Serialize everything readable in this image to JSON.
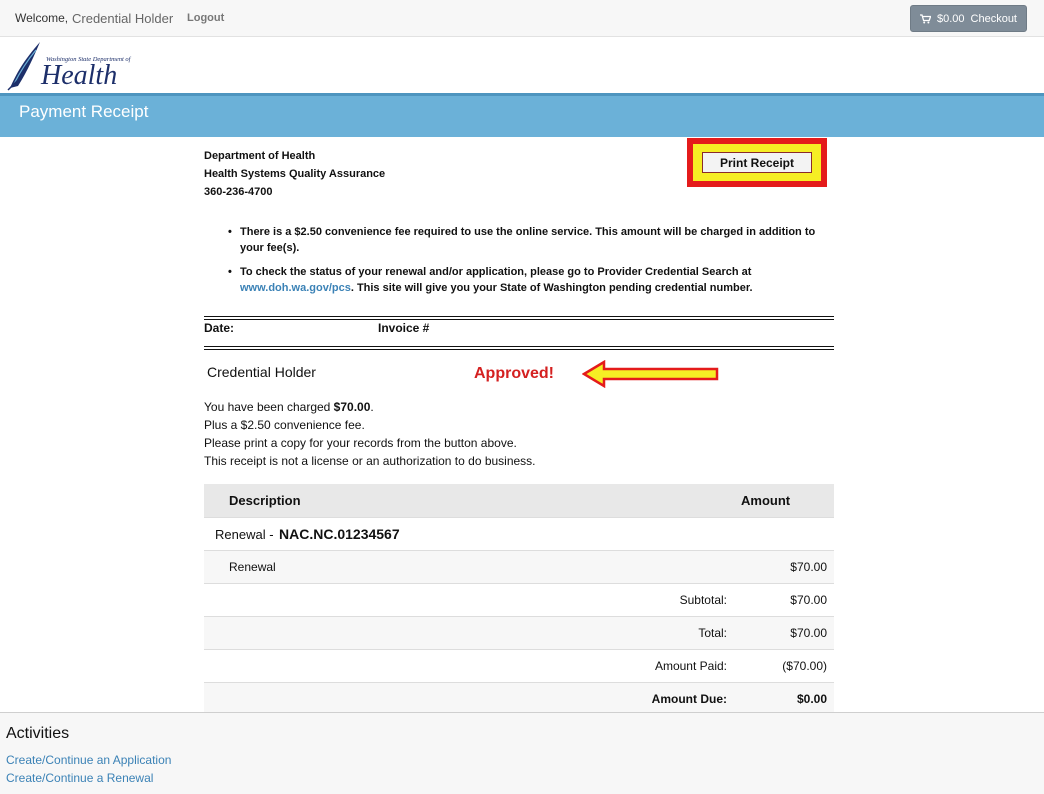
{
  "topbar": {
    "welcome": "Welcome,",
    "username": "Credential Holder",
    "logout": "Logout",
    "cart_amount": "$0.00",
    "checkout": "Checkout",
    "cart_icon": "shopping-cart-icon"
  },
  "logo": {
    "small_text": "Washington State Department of",
    "big_text": "Health"
  },
  "page_title": "Payment Receipt",
  "org": {
    "line1": "Department of Health",
    "line2": "Health Systems Quality Assurance",
    "phone": "360-236-4700"
  },
  "print_button": "Print Receipt",
  "notes": {
    "note1": "There is a $2.50 convenience fee required to use the online service. This amount will be charged in addition to your fee(s).",
    "note2_pre": "To check the status of your renewal and/or application, please go to Provider Credential Search at",
    "note2_link": "www.doh.wa.gov/pcs",
    "note2_post": ". This site will give you your State of Washington pending credential number."
  },
  "invoice": {
    "date_label": "Date:",
    "invoice_label": "Invoice #"
  },
  "holder_name": "Credential Holder",
  "approved": "Approved!",
  "charge": {
    "line1_pre": "You have been charged ",
    "line1_amount": "$70.00",
    "line1_post": ".",
    "line2": "Plus a $2.50 convenience fee.",
    "line3": "Please print a copy for your records from the button above.",
    "line4": "This receipt is not a license or an authorization to do business."
  },
  "table": {
    "col_description": "Description",
    "col_amount": "Amount",
    "group_prefix": "Renewal - ",
    "group_id": "NAC.NC.01234567",
    "item_desc": "Renewal",
    "item_amount": "$70.00",
    "subtotal_label": "Subtotal:",
    "subtotal": "$70.00",
    "total_label": "Total:",
    "total": "$70.00",
    "paid_label": "Amount Paid:",
    "paid": "($70.00)",
    "due_label": "Amount Due:",
    "due": "$0.00"
  },
  "activities": {
    "title": "Activities",
    "link1": "Create/Continue an Application",
    "link2": "Create/Continue a Renewal"
  },
  "colors": {
    "title_bar": "#6bb1d8",
    "highlight_red": "#e41b1b",
    "highlight_yellow": "#f6ee24",
    "link_blue": "#3b82b6"
  }
}
